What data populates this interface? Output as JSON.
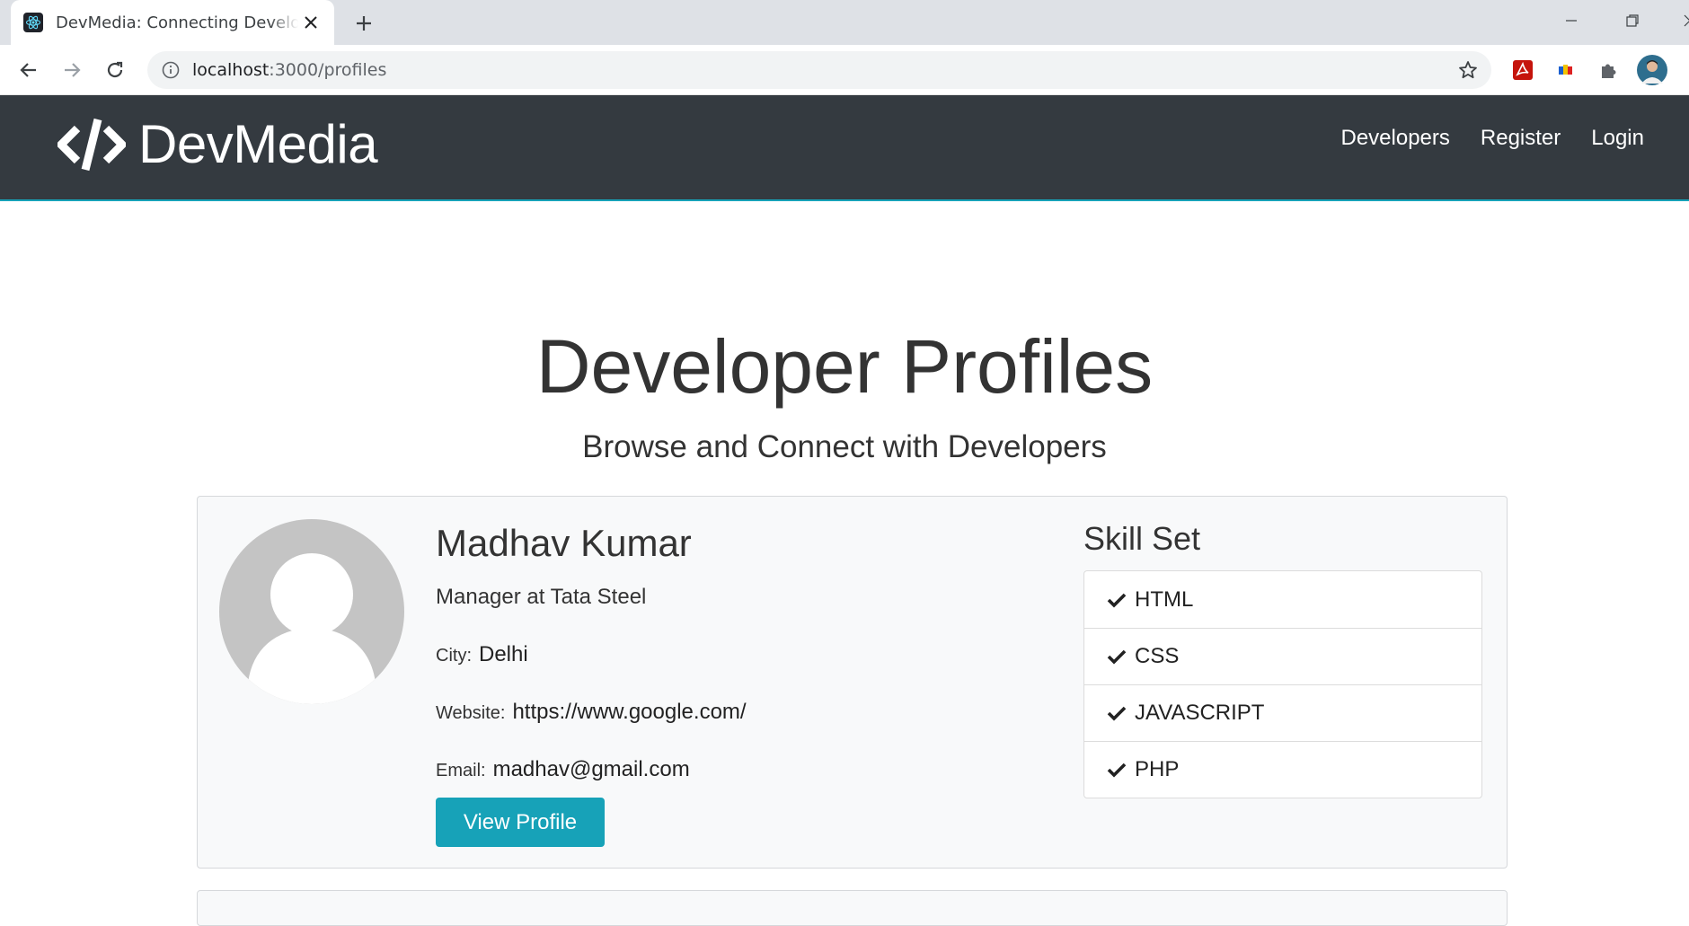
{
  "browser": {
    "tab_title": "DevMedia: Connecting Developers",
    "url_host": "localhost",
    "url_path": ":3000/profiles"
  },
  "navbar": {
    "brand": "DevMedia",
    "links": [
      "Developers",
      "Register",
      "Login"
    ]
  },
  "main": {
    "title": "Developer Profiles",
    "lead": "Browse and Connect with Developers"
  },
  "profiles": [
    {
      "name": "Madhav Kumar",
      "status": "Manager at Tata Steel",
      "city_label": "City:",
      "city": "Delhi",
      "website_label": "Website:",
      "website": "https://www.google.com/",
      "email_label": "Email:",
      "email": "madhav@gmail.com",
      "button_label": "View Profile",
      "skills_title": "Skill Set",
      "skills": [
        "HTML",
        "CSS",
        "JAVASCRIPT",
        "PHP"
      ]
    }
  ],
  "colors": {
    "navbar_bg": "#343a40",
    "accent": "#17a2b8",
    "card_bg": "#f8f9fa"
  },
  "icons": [
    "react-favicon-icon",
    "close-icon",
    "plus-icon",
    "back-icon",
    "forward-icon",
    "reload-icon",
    "info-icon",
    "star-icon",
    "pdf-extension-icon",
    "color-extension-icon",
    "puzzle-icon",
    "profile-avatar-icon",
    "code-logo-icon",
    "user-avatar-icon",
    "check-icon"
  ]
}
